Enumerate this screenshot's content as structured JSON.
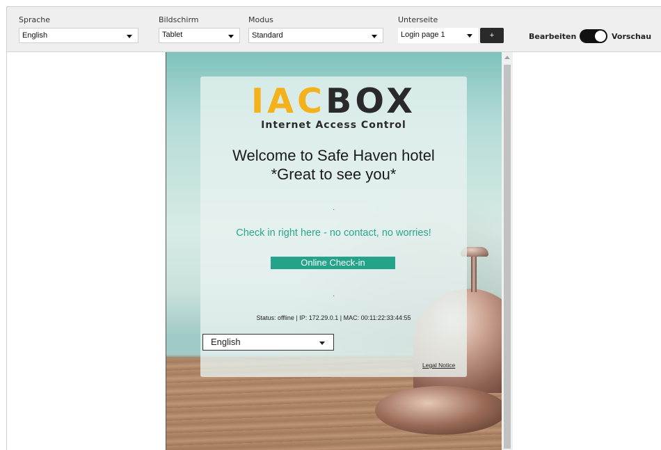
{
  "toolbar": {
    "language": {
      "label": "Sprache",
      "value": "English"
    },
    "screen": {
      "label": "Bildschirm",
      "value": "Tablet"
    },
    "mode": {
      "label": "Modus",
      "value": "Standard"
    },
    "subpage": {
      "label": "Unterseite",
      "value": "Login page 1"
    },
    "add_label": "+",
    "edit_label": "Bearbeiten",
    "preview_label": "Vorschau"
  },
  "login": {
    "logo_part1": "IAC",
    "logo_part2": "BOX",
    "logo_subtitle": "Internet Access Control",
    "welcome_line1": "Welcome to Safe Haven hotel",
    "welcome_line2": "*Great to see you*",
    "dot1": ".",
    "checkin_text": "Check in right here - no contact, no worries!",
    "checkin_button": "Online Check-in",
    "dot2": ".",
    "status": "Status: offline | IP: 172.29.0.1 | MAC: 00:11:22:33:44:55",
    "language_value": "English",
    "legal_notice": "Legal Notice"
  }
}
